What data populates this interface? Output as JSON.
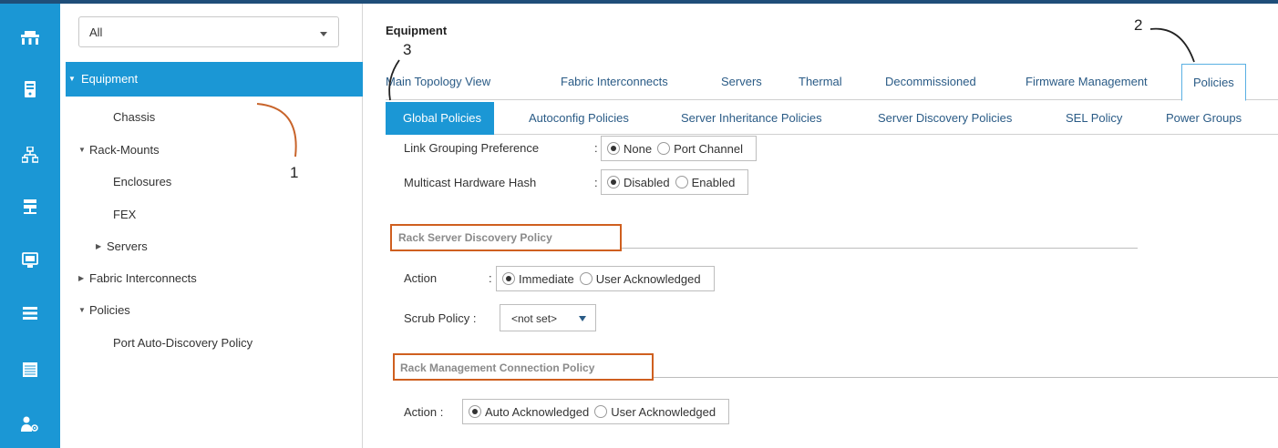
{
  "nav": {
    "filter_value": "All",
    "selected_item": "Equipment",
    "items": [
      "Chassis",
      "Rack-Mounts",
      "Enclosures",
      "FEX",
      "Servers",
      "Fabric Interconnects",
      "Policies",
      "Port Auto-Discovery Policy"
    ]
  },
  "rail_icons": [
    "equipment-icon",
    "servers-icon",
    "lan-icon",
    "san-icon",
    "vm-icon",
    "storage-icon",
    "chassis-icon",
    "admin-icon"
  ],
  "breadcrumb": "Equipment",
  "tabs": [
    "Main Topology View",
    "Fabric Interconnects",
    "Servers",
    "Thermal",
    "Decommissioned",
    "Firmware Management",
    "Policies"
  ],
  "subtabs": [
    "Global Policies",
    "Autoconfig Policies",
    "Server Inheritance Policies",
    "Server Discovery Policies",
    "SEL Policy",
    "Power Groups"
  ],
  "form": {
    "link_grouping": {
      "label": "Link Grouping Preference",
      "colon": ":",
      "options": [
        "None",
        "Port Channel"
      ],
      "selected": "None"
    },
    "multicast_hash": {
      "label": "Multicast Hardware Hash",
      "colon": ":",
      "options": [
        "Disabled",
        "Enabled"
      ],
      "selected": "Disabled"
    },
    "rack_discovery": {
      "title": "Rack Server Discovery Policy",
      "action_label": "Action",
      "colon": ":",
      "action_options": [
        "Immediate",
        "User Acknowledged"
      ],
      "action_selected": "Immediate",
      "scrub_label": "Scrub Policy :",
      "scrub_value": "<not set>"
    },
    "rack_mgmt": {
      "title": "Rack Management Connection Policy",
      "action_label": "Action :",
      "action_options": [
        "Auto Acknowledged",
        "User Acknowledged"
      ],
      "action_selected": "Auto Acknowledged"
    }
  },
  "annotations": [
    "1",
    "2",
    "3"
  ],
  "colors": {
    "rail": "#1b97d5",
    "selected": "#1b97d5",
    "link": "#2a5b86",
    "highlight": "#cf5f1f"
  }
}
